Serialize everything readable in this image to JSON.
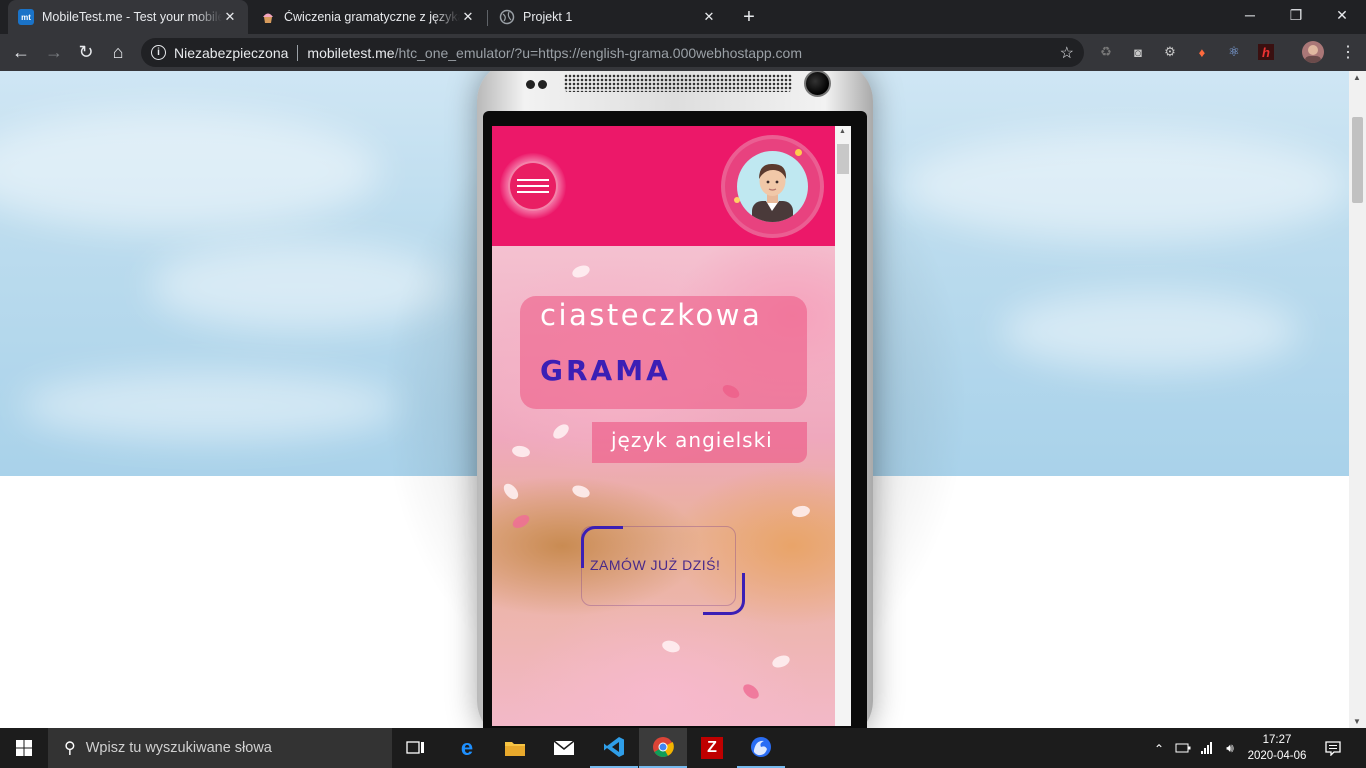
{
  "tabs": [
    {
      "favicon": "mt",
      "title": "MobileTest.me - Test your mobile",
      "active": true
    },
    {
      "favicon": "cupcake-icon",
      "title": "Ćwiczenia gramatyczne z języka a",
      "active": false
    },
    {
      "favicon": "globe-icon",
      "title": "Projekt 1",
      "active": false
    }
  ],
  "toolbar": {
    "security_label": "Niezabezpieczona",
    "url_host": "mobiletest.me",
    "url_path": "/htc_one_emulator/?u=https://english-grama.000webhostapp.com"
  },
  "site": {
    "title_top": "ciasteczkowa",
    "title_main": "GRAMA",
    "subtitle": "język angielski",
    "order_button": "ZAMÓW JUŻ DZIŚ!"
  },
  "taskbar": {
    "search_placeholder": "Wpisz tu wyszukiwane słowa",
    "time": "17:27",
    "date": "2020-04-06"
  },
  "colors": {
    "accent_pink": "#ec1869",
    "grama_purple": "#3b1fb5",
    "chrome_dark": "#202124"
  }
}
